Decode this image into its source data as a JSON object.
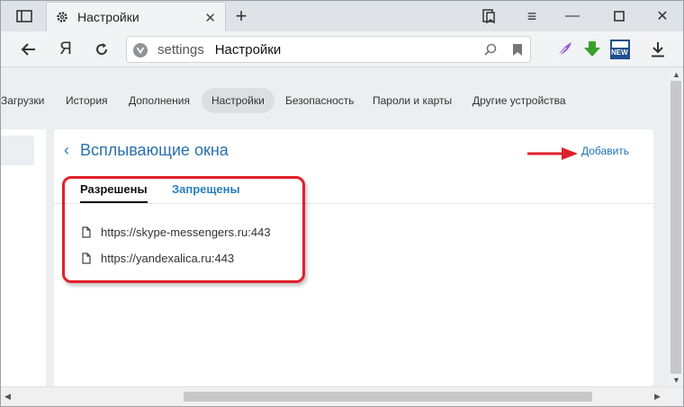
{
  "tab": {
    "title": "Настройки"
  },
  "address": {
    "host": "settings",
    "page_title": "Настройки"
  },
  "toolbar": {
    "yandex_label": "Я",
    "ext_news_label": "NEW"
  },
  "settings_nav": [
    {
      "label": "Загрузки"
    },
    {
      "label": "История"
    },
    {
      "label": "Дополнения"
    },
    {
      "label": "Настройки"
    },
    {
      "label": "Безопасность"
    },
    {
      "label": "Пароли и карты"
    },
    {
      "label": "Другие устройства"
    }
  ],
  "panel": {
    "title": "Всплывающие окна",
    "add_label": "Добавить",
    "tabs": [
      {
        "label": "Разрешены"
      },
      {
        "label": "Запрещены"
      }
    ],
    "sites": [
      {
        "url": "https://skype-messengers.ru:443"
      },
      {
        "url": "https://yandexalica.ru:443"
      }
    ]
  },
  "colors": {
    "accent": "#2a79b8",
    "highlight": "#e0202a",
    "download_icon": "#3aa02c"
  }
}
